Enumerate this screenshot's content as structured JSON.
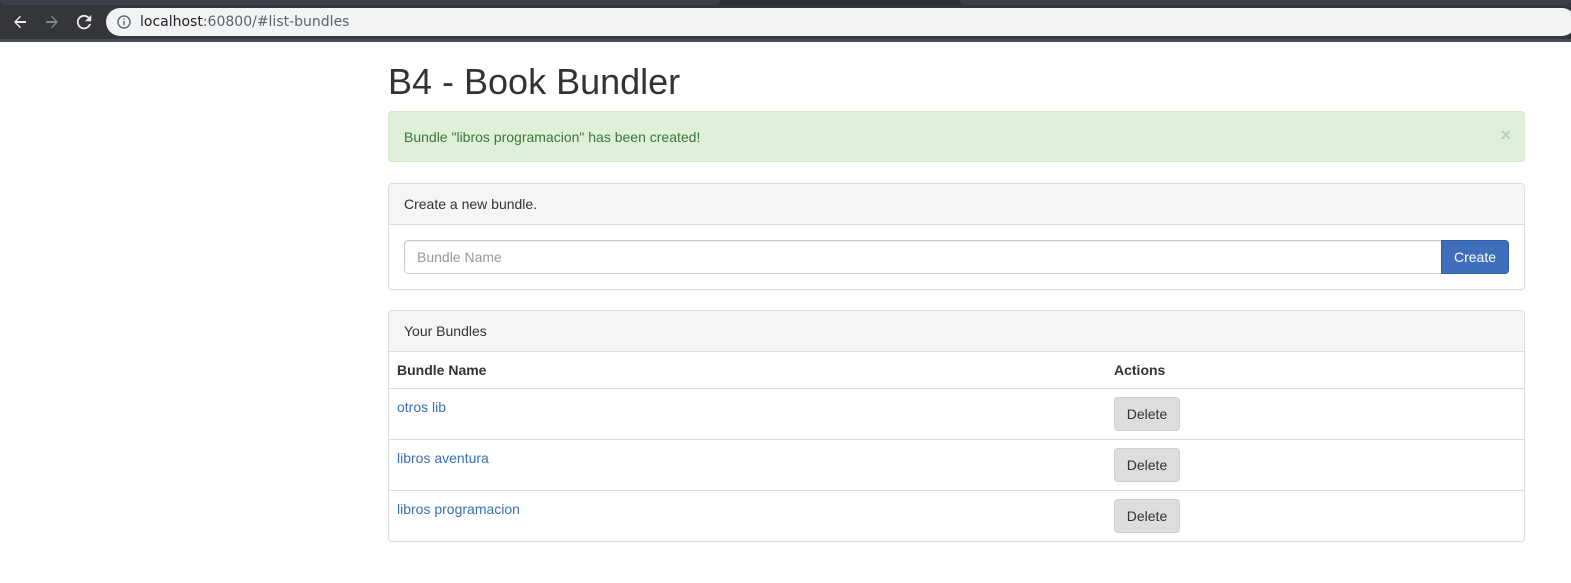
{
  "browser": {
    "url_host": "localhost",
    "url_rest": ":60800/#list-bundles"
  },
  "page": {
    "title": "B4 - Book Bundler"
  },
  "alert": {
    "message": "Bundle \"libros programacion\" has been created!",
    "close_label": "×"
  },
  "create_panel": {
    "heading": "Create a new bundle.",
    "input_placeholder": "Bundle Name",
    "input_value": "",
    "button_label": "Create"
  },
  "bundles_panel": {
    "heading": "Your Bundles",
    "columns": [
      "Bundle Name",
      "Actions"
    ],
    "rows": [
      {
        "name": "otros lib",
        "action": "Delete"
      },
      {
        "name": "libros aventura",
        "action": "Delete"
      },
      {
        "name": "libros programacion",
        "action": "Delete"
      }
    ]
  },
  "colors": {
    "success_bg": "#dff0d8",
    "success_text": "#3c763d",
    "primary": "#3f6fba",
    "link": "#3a6fb6"
  }
}
